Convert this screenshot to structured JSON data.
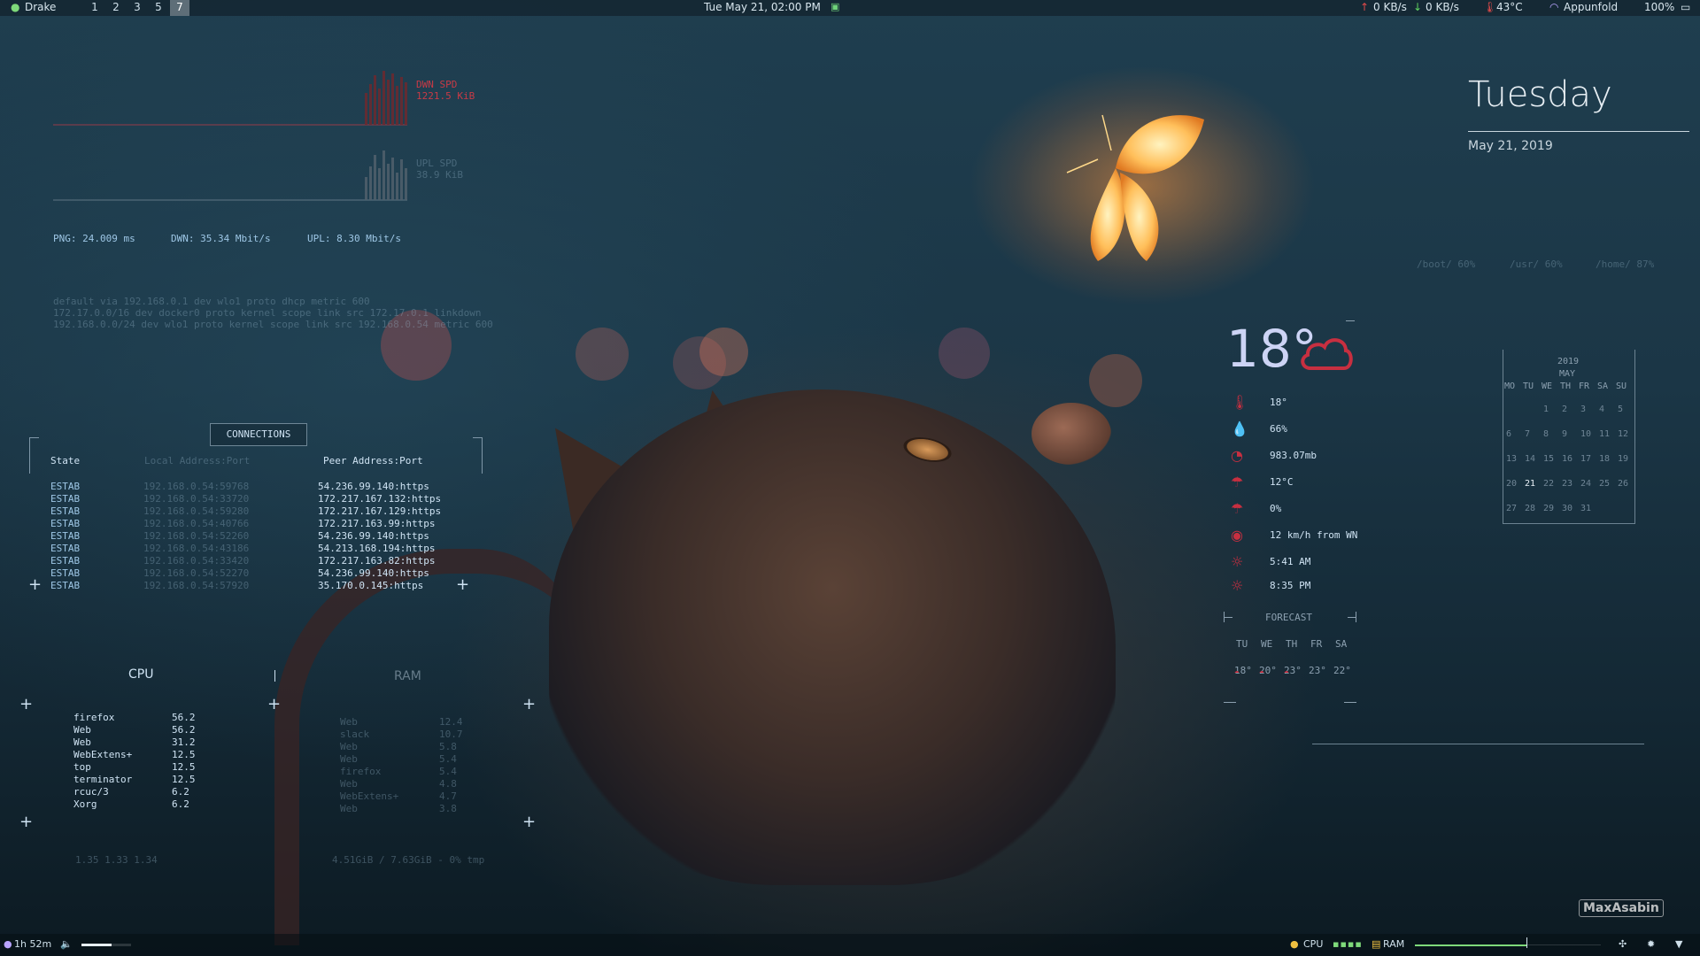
{
  "topbar": {
    "user": "Drake",
    "workspaces": [
      "1",
      "2",
      "3",
      "5",
      "7"
    ],
    "active_workspace": "7",
    "datetime": "Tue May 21, 02:00 PM",
    "net_up": "0 KB/s",
    "net_down": "0 KB/s",
    "temp": "43°C",
    "wifi": "Appunfold",
    "battery": "100%"
  },
  "network": {
    "down_label": "DWN SPD",
    "down_value": "1221.5 KiB",
    "up_label": "UPL SPD",
    "up_value": "38.9 KiB",
    "ping": "PNG: 24.009 ms",
    "down_rate": "DWN: 35.34 Mbit/s",
    "up_rate": "UPL: 8.30 Mbit/s",
    "routes": [
      "default via 192.168.0.1 dev wlo1 proto dhcp metric 600",
      "172.17.0.0/16 dev docker0 proto kernel scope link src 172.17.0.1 linkdown",
      "192.168.0.0/24 dev wlo1 proto kernel scope link src 192.168.0.54 metric 600"
    ]
  },
  "connections": {
    "title": "CONNECTIONS",
    "headers": [
      "State",
      "Local Address:Port",
      "Peer Address:Port"
    ],
    "rows": [
      [
        "ESTAB",
        "192.168.0.54:59768",
        "54.236.99.140:https"
      ],
      [
        "ESTAB",
        "192.168.0.54:33720",
        "172.217.167.132:https"
      ],
      [
        "ESTAB",
        "192.168.0.54:59280",
        "172.217.167.129:https"
      ],
      [
        "ESTAB",
        "192.168.0.54:40766",
        "172.217.163.99:https"
      ],
      [
        "ESTAB",
        "192.168.0.54:52260",
        "54.236.99.140:https"
      ],
      [
        "ESTAB",
        "192.168.0.54:43186",
        "54.213.168.194:https"
      ],
      [
        "ESTAB",
        "192.168.0.54:33420",
        "172.217.163.82:https"
      ],
      [
        "ESTAB",
        "192.168.0.54:52270",
        "54.236.99.140:https"
      ],
      [
        "ESTAB",
        "192.168.0.54:57920",
        "35.170.0.145:https"
      ]
    ]
  },
  "cpu": {
    "title": "CPU",
    "processes": [
      [
        "firefox",
        "56.2"
      ],
      [
        "Web",
        "56.2"
      ],
      [
        "Web",
        "31.2"
      ],
      [
        "WebExtens+",
        "12.5"
      ],
      [
        "top",
        "12.5"
      ],
      [
        "terminator",
        "12.5"
      ],
      [
        "rcuc/3",
        "6.2"
      ],
      [
        "Xorg",
        "6.2"
      ]
    ],
    "footer": "1.35  1.33  1.34"
  },
  "ram": {
    "title": "RAM",
    "processes": [
      [
        "Web",
        "12.4"
      ],
      [
        "slack",
        "10.7"
      ],
      [
        "Web",
        "5.8"
      ],
      [
        "Web",
        "5.4"
      ],
      [
        "firefox",
        "5.4"
      ],
      [
        "Web",
        "4.8"
      ],
      [
        "WebExtens+",
        "4.7"
      ],
      [
        "Web",
        "3.8"
      ]
    ],
    "footer": "4.51GiB / 7.63GiB - 0% tmp"
  },
  "date_panel": {
    "day": "Tuesday",
    "date": "May 21, 2019"
  },
  "disks": [
    "/boot/ 60%",
    "/usr/ 60%",
    "/home/ 87%"
  ],
  "weather": {
    "temperature": "18°",
    "details": [
      {
        "icon": "thermometer-icon",
        "glyph": "🌡",
        "value": "18°"
      },
      {
        "icon": "humidity-icon",
        "glyph": "💧",
        "value": "66%"
      },
      {
        "icon": "pressure-icon",
        "glyph": "◔",
        "value": "983.07mb"
      },
      {
        "icon": "dew-point-icon",
        "glyph": "☂",
        "value": "12°C"
      },
      {
        "icon": "rain-chance-icon",
        "glyph": "☂",
        "value": "0%"
      },
      {
        "icon": "wind-icon",
        "glyph": "◉",
        "value": "12 km/h from WN"
      },
      {
        "icon": "sunrise-icon",
        "glyph": "☼",
        "value": "5:41 AM"
      },
      {
        "icon": "sunset-icon",
        "glyph": "☼",
        "value": "8:35 PM"
      }
    ],
    "forecast_title": "FORECAST",
    "forecast_days": [
      "TU",
      "WE",
      "TH",
      "FR",
      "SA"
    ],
    "forecast_temps": [
      "18°",
      "20°",
      "23°",
      "23°",
      "22°"
    ]
  },
  "calendar": {
    "year": "2019",
    "month": "MAY",
    "weekdays": [
      "MO",
      "TU",
      "WE",
      "TH",
      "FR",
      "SA",
      "SU"
    ],
    "weeks": [
      [
        "",
        "",
        "1",
        "2",
        "3",
        "4",
        "5"
      ],
      [
        "6",
        "7",
        "8",
        "9",
        "10",
        "11",
        "12"
      ],
      [
        "13",
        "14",
        "15",
        "16",
        "17",
        "18",
        "19"
      ],
      [
        "20",
        "21",
        "22",
        "23",
        "24",
        "25",
        "26"
      ],
      [
        "27",
        "28",
        "29",
        "30",
        "31",
        "",
        ""
      ]
    ],
    "today": "21"
  },
  "bottombar": {
    "uptime": "1h 52m",
    "volume_level": 0.6,
    "cpu_label": "CPU",
    "ram_label": "RAM",
    "watermark": "MaxAsabin"
  },
  "colors": {
    "accent_red": "#c83a46",
    "text_blue": "#9fc6e0",
    "active_workspace_bg": "#5e6e78"
  }
}
